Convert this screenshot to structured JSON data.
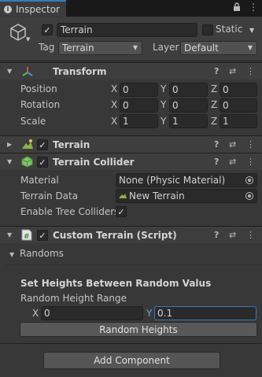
{
  "tab": {
    "title": "Inspector",
    "lock_icon": "lock-icon",
    "menu_icon": "kebab-menu-icon"
  },
  "object": {
    "active": true,
    "name": "Terrain",
    "static_label": "Static",
    "static_checked": false,
    "tag_label": "Tag",
    "tag_value": "Terrain",
    "layer_label": "Layer",
    "layer_value": "Default"
  },
  "transform": {
    "title": "Transform",
    "rows": [
      {
        "label": "Position",
        "x": "0",
        "y": "0",
        "z": "0"
      },
      {
        "label": "Rotation",
        "x": "0",
        "y": "0",
        "z": "0"
      },
      {
        "label": "Scale",
        "x": "1",
        "y": "1",
        "z": "1"
      }
    ],
    "axes": {
      "x": "X",
      "y": "Y",
      "z": "Z"
    }
  },
  "terrain": {
    "title": "Terrain",
    "enabled": true
  },
  "terrain_collider": {
    "title": "Terrain Collider",
    "enabled": true,
    "material_label": "Material",
    "material_value": "None (Physic Material)",
    "data_label": "Terrain Data",
    "data_value": "New Terrain",
    "trees_label": "Enable Tree Colliders",
    "trees_checked": true
  },
  "custom_terrain": {
    "title": "Custom Terrain (Script)",
    "enabled": true,
    "randoms_label": "Randoms",
    "section_title": "Set Heights Between Random Valus",
    "range_label": "Random Height Range",
    "x_axis": "X",
    "x_value": "0",
    "y_axis": "Y",
    "y_value": "0.1",
    "button_label": "Random Heights"
  },
  "add_component_label": "Add Component",
  "colors": {
    "accent": "#3a79bb",
    "panel": "#383838",
    "header": "#3e3e3e",
    "field": "#2a2a2a"
  }
}
